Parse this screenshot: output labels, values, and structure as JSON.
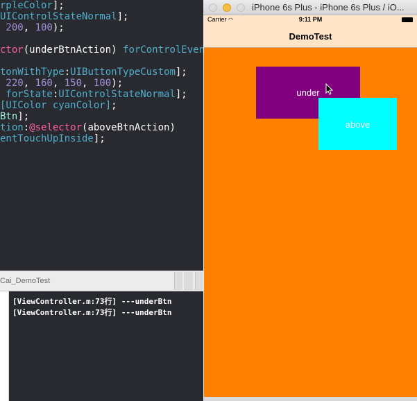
{
  "editor": {
    "lines": [
      [
        {
          "t": "rpleColor",
          "c": "tok-cyan"
        },
        {
          "t": "];",
          "c": "tok-white"
        }
      ],
      [
        {
          "t": "UIControlStateNormal",
          "c": "tok-cyan"
        },
        {
          "t": "];",
          "c": "tok-white"
        }
      ],
      [
        {
          "t": " 200",
          "c": "tok-purple"
        },
        {
          "t": ", ",
          "c": "tok-white"
        },
        {
          "t": "100",
          "c": "tok-purple"
        },
        {
          "t": ");",
          "c": "tok-white"
        }
      ],
      [],
      [
        {
          "t": "ctor",
          "c": "tok-pink"
        },
        {
          "t": "(underBtnAction) ",
          "c": "tok-white"
        },
        {
          "t": "forControlEvent",
          "c": "tok-cyan"
        }
      ],
      [],
      [
        {
          "t": "tonWithType",
          "c": "tok-cyan"
        },
        {
          "t": ":",
          "c": "tok-white"
        },
        {
          "t": "UIButtonTypeCustom",
          "c": "tok-cyan"
        },
        {
          "t": "];",
          "c": "tok-white"
        }
      ],
      [
        {
          "t": " 220",
          "c": "tok-purple"
        },
        {
          "t": ", ",
          "c": "tok-white"
        },
        {
          "t": "160",
          "c": "tok-purple"
        },
        {
          "t": ", ",
          "c": "tok-white"
        },
        {
          "t": "150",
          "c": "tok-purple"
        },
        {
          "t": ", ",
          "c": "tok-white"
        },
        {
          "t": "100",
          "c": "tok-purple"
        },
        {
          "t": ");",
          "c": "tok-white"
        }
      ],
      [
        {
          "t": " forState",
          "c": "tok-cyan"
        },
        {
          "t": ":",
          "c": "tok-white"
        },
        {
          "t": "UIControlStateNormal",
          "c": "tok-cyan"
        },
        {
          "t": "];",
          "c": "tok-white"
        }
      ],
      [
        {
          "t": "[UIColor cyanColor]",
          "c": "tok-cyan"
        },
        {
          "t": ";",
          "c": "tok-white"
        }
      ],
      [
        {
          "t": "Btn",
          "c": "tok-green"
        },
        {
          "t": "];",
          "c": "tok-white"
        }
      ],
      [
        {
          "t": "tion",
          "c": "tok-cyan"
        },
        {
          "t": ":",
          "c": "tok-white"
        },
        {
          "t": "@selector",
          "c": "tok-pink"
        },
        {
          "t": "(aboveBtnAction)",
          "c": "tok-white"
        }
      ],
      [
        {
          "t": "entTouchUpInside",
          "c": "tok-cyan"
        },
        {
          "t": "];",
          "c": "tok-white"
        }
      ]
    ]
  },
  "console": {
    "title": "Cai_DemoTest",
    "logs": [
      "[ViewController.m:73行] ---underBtn",
      "[ViewController.m:73行] ---underBtn"
    ]
  },
  "simulator": {
    "window_title": "iPhone 6s Plus - iPhone 6s Plus / iO...",
    "status": {
      "carrier": "Carrier",
      "time": "9:11 PM"
    },
    "nav_title": "DemoTest",
    "buttons": {
      "under": "under",
      "above": "above"
    },
    "colors": {
      "background": "#ff8000",
      "under": "#800080",
      "above": "#00ffff",
      "navbar": "#ffe4c8"
    }
  }
}
